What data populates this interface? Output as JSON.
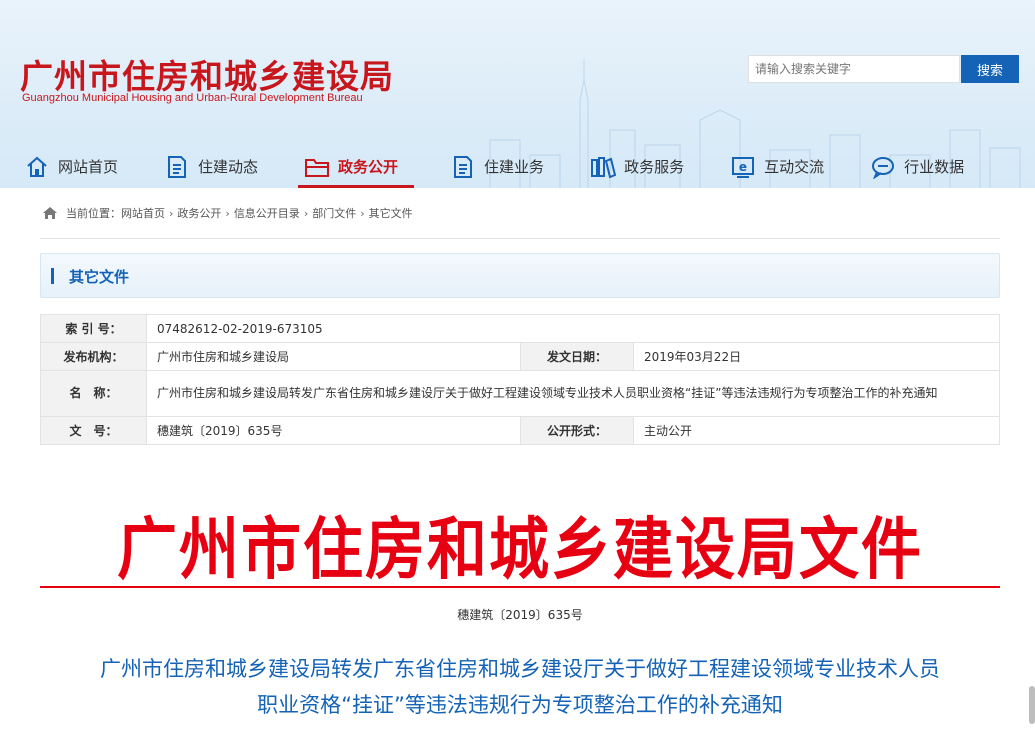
{
  "site": {
    "name_cn": "广州市住房和城乡建设局",
    "name_en": "Guangzhou Municipal Housing and Urban-Rural Development Bureau"
  },
  "search": {
    "placeholder": "请输入搜索关键字",
    "button_label": "搜索"
  },
  "nav": {
    "items": [
      {
        "label": "网站首页",
        "icon": "home-icon"
      },
      {
        "label": "住建动态",
        "icon": "document-icon"
      },
      {
        "label": "政务公开",
        "icon": "folder-icon",
        "active": true
      },
      {
        "label": "住建业务",
        "icon": "document-icon"
      },
      {
        "label": "政务服务",
        "icon": "books-icon"
      },
      {
        "label": "互动交流",
        "icon": "e-icon"
      },
      {
        "label": "行业数据",
        "icon": "chat-icon"
      }
    ]
  },
  "breadcrumb": {
    "prefix": "当前位置：",
    "items": [
      "网站首页",
      "政务公开",
      "信息公开目录",
      "部门文件",
      "其它文件"
    ],
    "separator": "›"
  },
  "section": {
    "title": "其它文件"
  },
  "info": {
    "index_label": "索 引 号：",
    "index_value": "07482612-02-2019-673105",
    "publisher_label": "发布机构：",
    "publisher_value": "广州市住房和城乡建设局",
    "date_label": "发文日期：",
    "date_value": "2019年03月22日",
    "name_label": "名　称：",
    "name_value": "广州市住房和城乡建设局转发广东省住房和城乡建设厅关于做好工程建设领域专业技术人员职业资格“挂证”等违法违规行为专项整治工作的补充通知",
    "docno_label": "文　号：",
    "docno_value": "穗建筑〔2019〕635号",
    "form_label": "公开形式：",
    "form_value": "主动公开"
  },
  "document": {
    "red_heading": "广州市住房和城乡建设局文件",
    "doc_number": "穗建筑〔2019〕635号",
    "title_line1": "广州市住房和城乡建设局转发广东省住房和城乡建设厅关于做好工程建设领域专业技术人员",
    "title_line2": "职业资格“挂证”等违法违规行为专项整治工作的补充通知"
  },
  "colors": {
    "brand_red": "#c8161d",
    "heading_red": "#e60012",
    "brand_blue": "#1463b6"
  }
}
